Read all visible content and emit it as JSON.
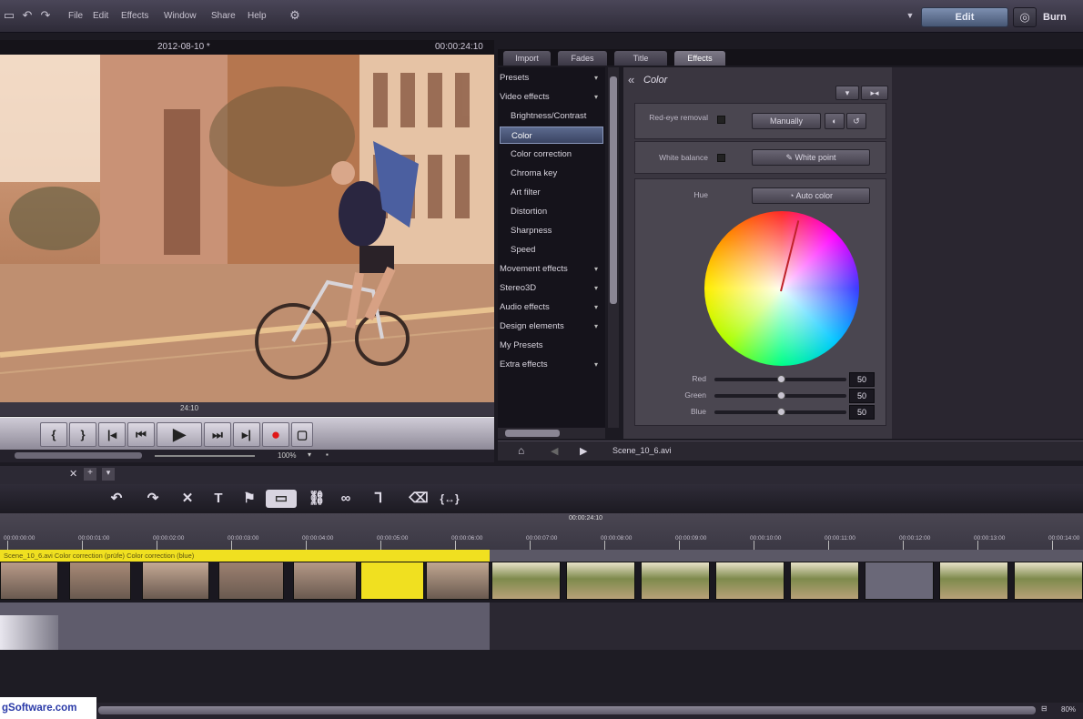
{
  "menubar": {
    "items": [
      "File",
      "Edit",
      "Effects",
      "Window",
      "Share",
      "Help"
    ],
    "edit_label": "Edit",
    "burn_label": "Burn"
  },
  "preview": {
    "date": "2012-08-10 *",
    "timecode": "00:00:24:10",
    "position": "24:10",
    "zoom": "100%"
  },
  "tabs": [
    "Import",
    "Fades",
    "Title",
    "Effects"
  ],
  "effects_list": [
    {
      "label": "Presets",
      "level": 0
    },
    {
      "label": "Video effects",
      "level": 0
    },
    {
      "label": "Brightness/Contrast",
      "level": 1
    },
    {
      "label": "Color",
      "level": 1,
      "selected": true
    },
    {
      "label": "Color correction",
      "level": 1
    },
    {
      "label": "Chroma key",
      "level": 1
    },
    {
      "label": "Art filter",
      "level": 1
    },
    {
      "label": "Distortion",
      "level": 1
    },
    {
      "label": "Sharpness",
      "level": 1
    },
    {
      "label": "Speed",
      "level": 1
    },
    {
      "label": "Movement effects",
      "level": 0
    },
    {
      "label": "Stereo3D",
      "level": 0
    },
    {
      "label": "Audio effects",
      "level": 0
    },
    {
      "label": "Design elements",
      "level": 0
    },
    {
      "label": "My Presets",
      "level": 0
    },
    {
      "label": "Extra effects",
      "level": 0
    }
  ],
  "color_panel": {
    "title": "Color",
    "red_eye_label": "Red-eye removal",
    "manually_label": "Manually",
    "white_balance_label": "White balance",
    "white_point_label": "White point",
    "hue_label": "Hue",
    "auto_color_label": "Auto color",
    "sliders": [
      {
        "label": "Red",
        "value": "50",
        "level": 0.5
      },
      {
        "label": "Green",
        "value": "50",
        "level": 0.5
      },
      {
        "label": "Blue",
        "value": "50",
        "level": 0.5
      }
    ]
  },
  "fx_footer": {
    "filename": "Scene_10_6.avi"
  },
  "timeline": {
    "center_time": "00:00:24:10",
    "ticks": [
      "00:00:00:00",
      "00:00:01:00",
      "00:00:02:00",
      "00:00:03:00",
      "00:00:04:00",
      "00:00:05:00",
      "00:00:06:00",
      "00:00:07:00",
      "00:00:08:00",
      "00:00:09:00",
      "00:00:10:00",
      "00:00:11:00",
      "00:00:12:00",
      "00:00:13:00",
      "00:00:14:00"
    ],
    "track1_label": "Scene_10_6.avi   Color correction (prüfe)   Color correction (blue)"
  },
  "watermark": "gSoftware.com",
  "zoom_pct": "80%"
}
